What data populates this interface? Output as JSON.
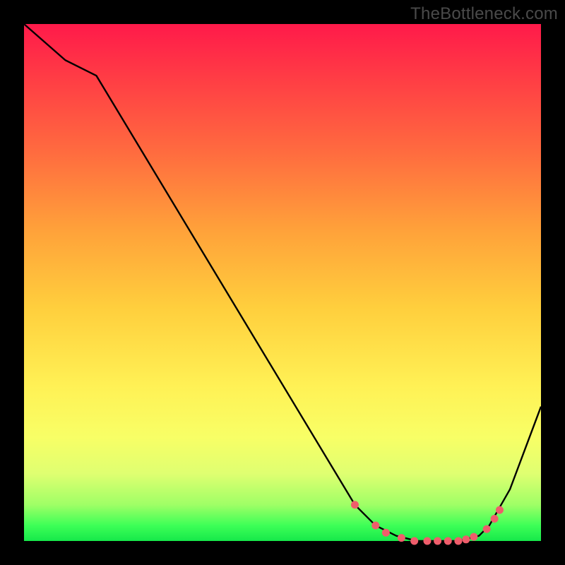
{
  "watermark": "TheBottleneck.com",
  "chart_data": {
    "type": "line",
    "title": "",
    "xlabel": "",
    "ylabel": "",
    "xlim": [
      0,
      100
    ],
    "ylim": [
      0,
      100
    ],
    "curve": {
      "x": [
        0,
        8,
        14,
        64,
        68,
        72,
        76,
        80,
        84,
        88,
        90,
        94,
        100
      ],
      "y": [
        100,
        93,
        90,
        7,
        3,
        1,
        0,
        0,
        0,
        1,
        3,
        10,
        26
      ]
    },
    "markers": {
      "x": [
        64.0,
        68.0,
        70.0,
        73.0,
        75.5,
        78.0,
        80.0,
        82.0,
        84.0,
        85.5,
        87.0,
        89.5,
        91.0,
        92.0
      ],
      "y": [
        7.0,
        3.0,
        1.6,
        0.6,
        0.0,
        0.0,
        0.0,
        0.0,
        0.0,
        0.3,
        0.8,
        2.3,
        4.3,
        6.0
      ]
    },
    "colors": {
      "curve": "#000000",
      "marker": "#ef5d6b"
    }
  }
}
